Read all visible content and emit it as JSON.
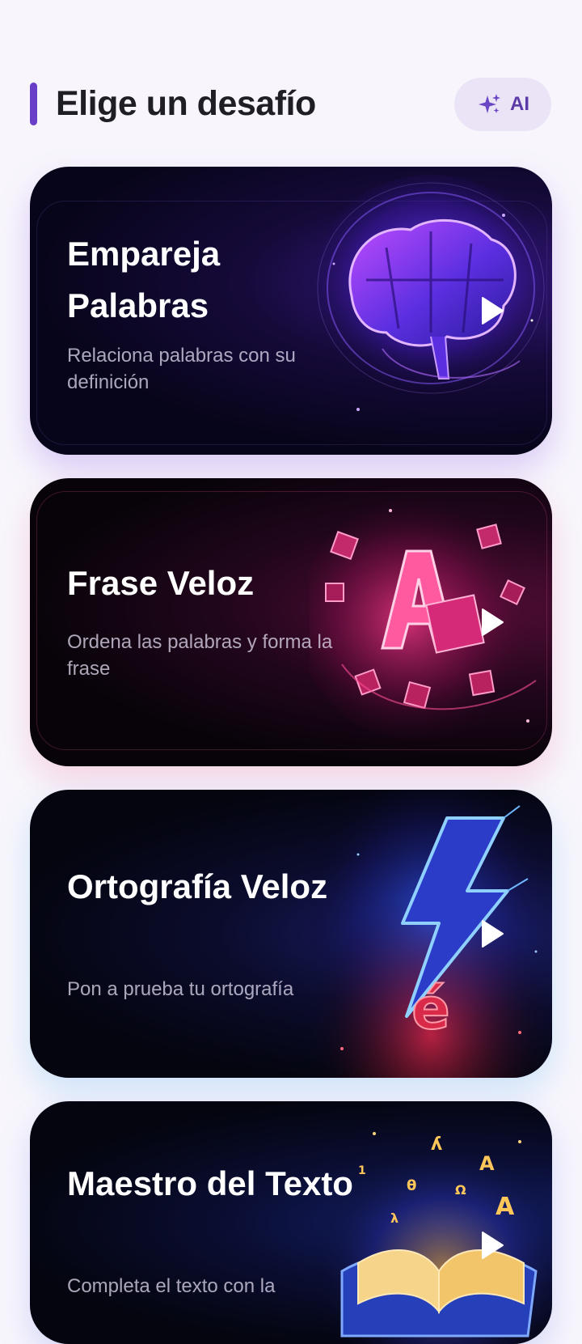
{
  "header": {
    "title": "Elige un desafío",
    "ai_button": {
      "label": "AI",
      "icon": "sparkles-icon"
    }
  },
  "colors": {
    "accent": "#6a3fc8",
    "ai_button_bg": "#ebe4f6",
    "ai_button_text": "#5b3aa8",
    "page_bg": "#f8f6fc"
  },
  "challenges": [
    {
      "title": "Empareja Palabras",
      "description": "Relaciona palabras con su definición",
      "art": "brain-puzzle-image",
      "action_icon": "play-icon"
    },
    {
      "title": "Frase Veloz",
      "description": "Ordena las palabras y forma la frase",
      "art": "letter-blocks-image",
      "action_icon": "play-icon"
    },
    {
      "title": "Ortografía Veloz",
      "description": "Pon a prueba tu ortografía",
      "art": "lightning-bolt-image",
      "action_icon": "play-icon"
    },
    {
      "title": "Maestro del Texto",
      "description": "Completa el texto con la",
      "art": "magic-book-image",
      "action_icon": "play-icon"
    }
  ]
}
